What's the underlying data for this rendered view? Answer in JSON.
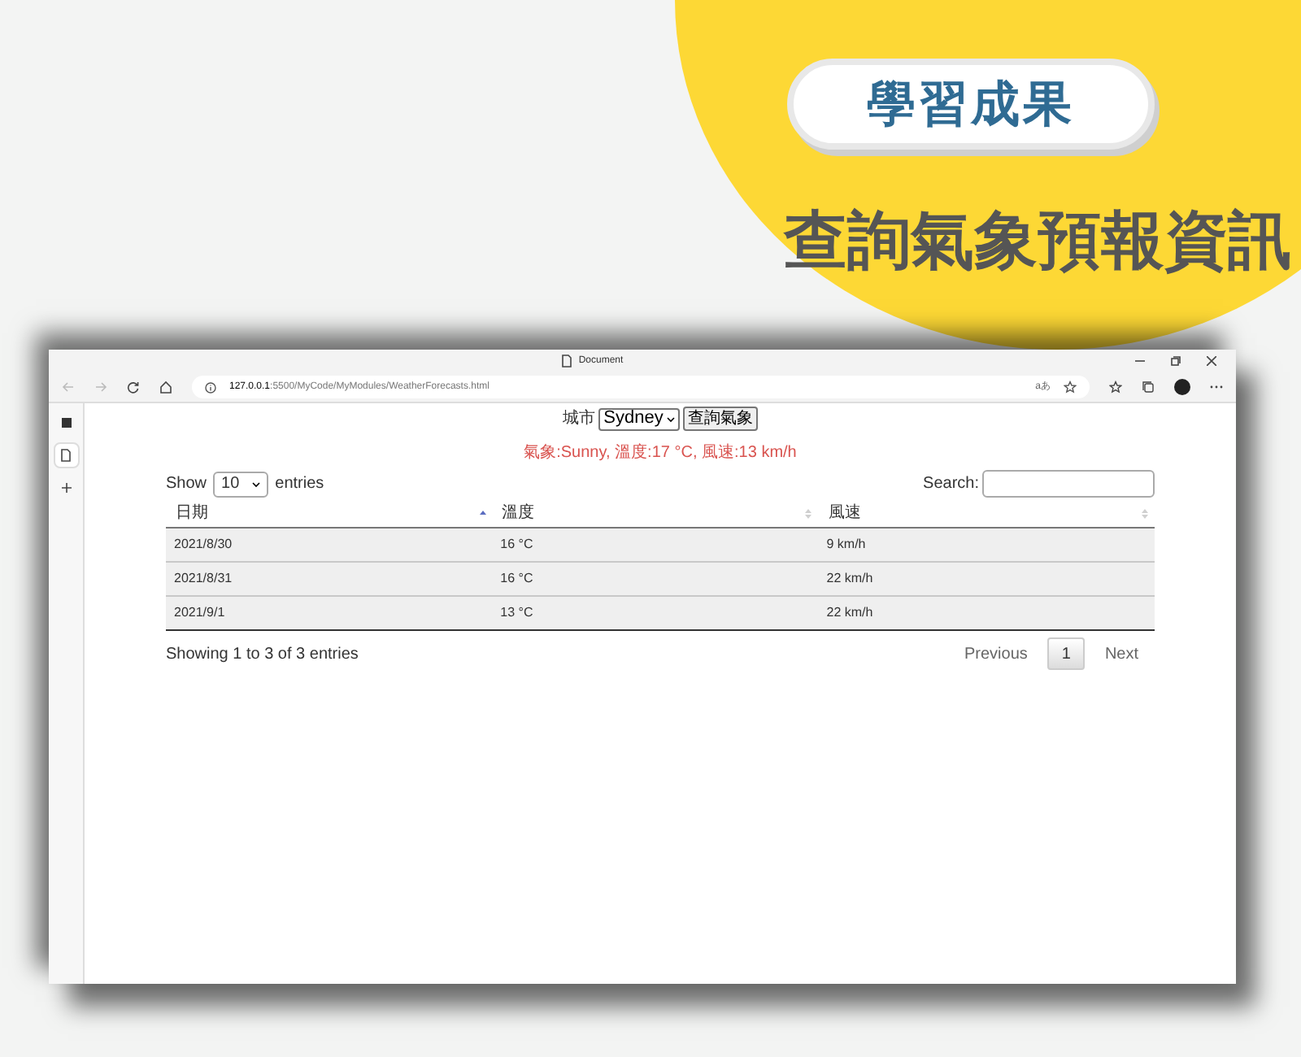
{
  "banner": {
    "badge": "學習成果",
    "title": "查詢氣象預報資訊"
  },
  "browser": {
    "tab_title": "Document",
    "url_host": "127.0.0.1",
    "url_path": ":5500/MyCode/MyModules/WeatherForecasts.html",
    "reader_label": "aあ"
  },
  "page": {
    "city_label": "城市",
    "city_value": "Sydney",
    "query_button": "查詢氣象",
    "result": "氣象:Sunny, 溫度:17 °C, 風速:13 km/h",
    "length_prefix": "Show",
    "length_value": "10",
    "length_suffix": "entries",
    "search_label": "Search:",
    "columns": [
      {
        "label": "日期",
        "sorted": true
      },
      {
        "label": "溫度",
        "sorted": false
      },
      {
        "label": "風速",
        "sorted": false
      }
    ],
    "rows": [
      [
        "2021/8/30",
        "16 °C",
        "9 km/h"
      ],
      [
        "2021/8/31",
        "16 °C",
        "22 km/h"
      ],
      [
        "2021/9/1",
        "13 °C",
        "22 km/h"
      ]
    ],
    "info": "Showing 1 to 3 of 3 entries",
    "pagination": [
      {
        "label": "Previous",
        "selected": false
      },
      {
        "label": "1",
        "selected": true
      },
      {
        "label": "Next",
        "selected": false
      }
    ]
  }
}
